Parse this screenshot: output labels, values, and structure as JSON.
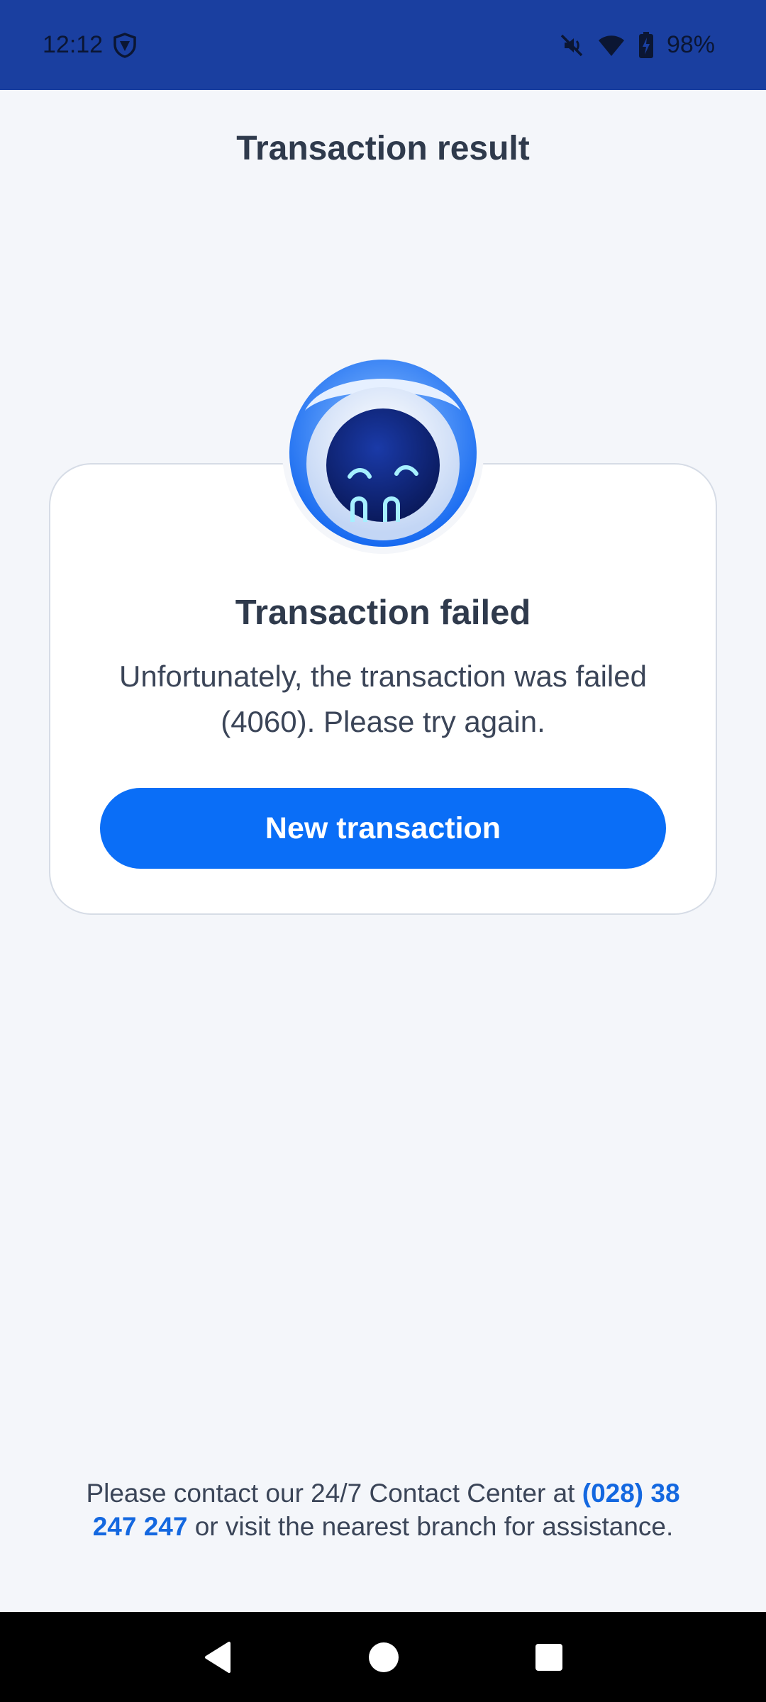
{
  "status_bar": {
    "time": "12:12",
    "battery_percent": "98%",
    "icons": [
      "vpn-shield-icon",
      "mute-icon",
      "wifi-icon",
      "battery-charging-icon"
    ]
  },
  "header": {
    "title": "Transaction result"
  },
  "result": {
    "title": "Transaction failed",
    "message": "Unfortunately, the transaction was failed (4060). Please try again.",
    "button_label": "New transaction"
  },
  "contact": {
    "prefix": "Please contact our 24/7 Contact Center at",
    "phone": "(028) 38 247 247",
    "suffix": "or visit the nearest branch for assistance."
  },
  "colors": {
    "status_bar": "#1a3fa0",
    "accent": "#0a6ef7",
    "link": "#1468e0",
    "background": "#f4f6fa"
  },
  "nav": {
    "icons": [
      "back-icon",
      "home-icon",
      "recents-icon"
    ]
  }
}
